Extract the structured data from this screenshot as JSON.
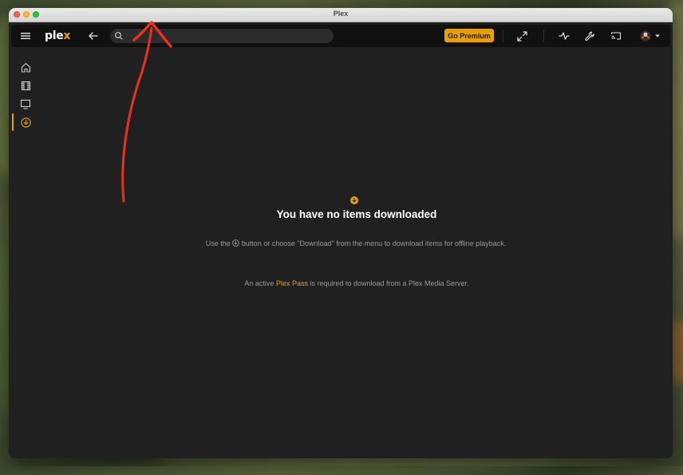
{
  "window": {
    "title": "Plex"
  },
  "topbar": {
    "logo_main": "ple",
    "logo_x": "x",
    "search": {
      "value": "",
      "placeholder": ""
    },
    "premium_label": "Go Premium"
  },
  "sidebar": {
    "items": [
      {
        "name": "home",
        "icon": "home-icon",
        "active": false
      },
      {
        "name": "movies",
        "icon": "film-icon",
        "active": false
      },
      {
        "name": "tv",
        "icon": "tv-icon",
        "active": false
      },
      {
        "name": "downloads",
        "icon": "download-circle-icon",
        "active": true
      }
    ]
  },
  "empty_state": {
    "title": "You have no items downloaded",
    "desc_before": "Use the ",
    "desc_after": " button or choose \"Download\" from the menu to download items for offline playback.",
    "note_before": "An active ",
    "note_link": "Plex Pass",
    "note_after": " is required to download from a Plex Media Server."
  },
  "colors": {
    "accent": "#e5a00d",
    "annotation": "#e8321f",
    "background": "#202020",
    "topbar": "#111111"
  }
}
